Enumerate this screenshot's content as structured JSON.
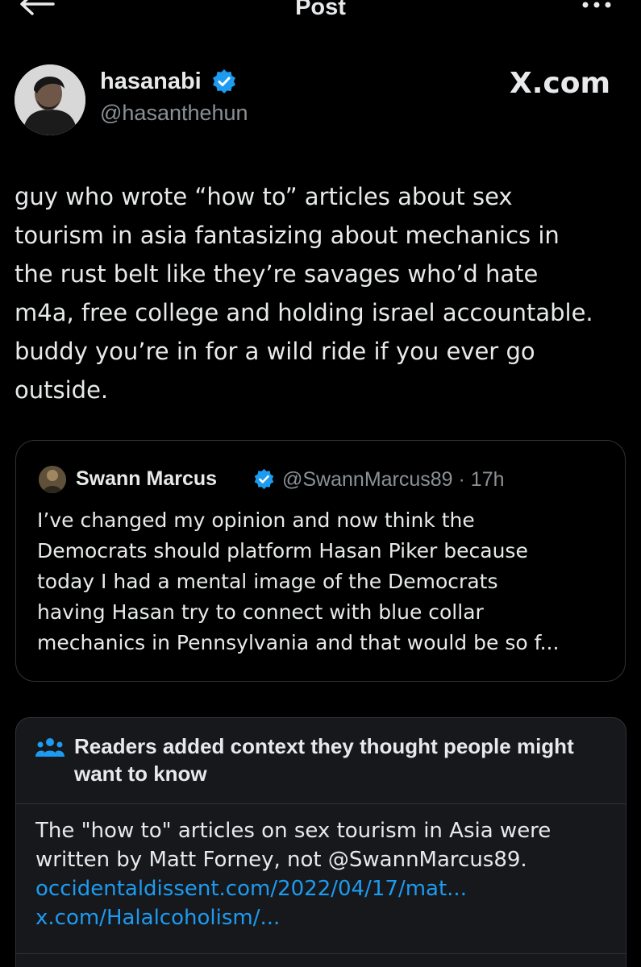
{
  "header": {
    "title": "Post",
    "back_icon": "arrow-left-icon",
    "more_icon": "more-horizontal-icon"
  },
  "author": {
    "display_name": "hasanabi",
    "handle": "@hasanthehun",
    "verified": true,
    "verified_color": "#1d9bf0"
  },
  "watermark": "X.com",
  "tweet": {
    "text": "guy who wrote “how to” articles about sex\ntourism in asia fantasizing about mechanics in\nthe rust belt like they’re savages who’d hate\nm4a, free college and holding israel accountable.\nbuddy you’re in for a wild ride if you ever go\noutside."
  },
  "quote": {
    "display_name": "Swann Marcus",
    "handle_time": "@SwannMarcus89 · 17h",
    "text": "I’ve changed my opinion and now think the\nDemocrats should platform Hasan Piker because\ntoday I had a mental image of the Democrats\nhaving Hasan try to connect with blue collar\nmechanics in Pennsylvania and that would be so f..."
  },
  "community_note": {
    "icon": "people-icon",
    "title": "Readers added context they thought people might want to know",
    "body": "The \"how to\" articles on sex tourism in Asia were\nwritten by Matt Forney, not @SwannMarcus89.",
    "link1": "occidentaldissent.com/2022/04/17/mat...",
    "link2": "x.com/Halalcoholism/...",
    "link_color": "#1d9bf0"
  }
}
